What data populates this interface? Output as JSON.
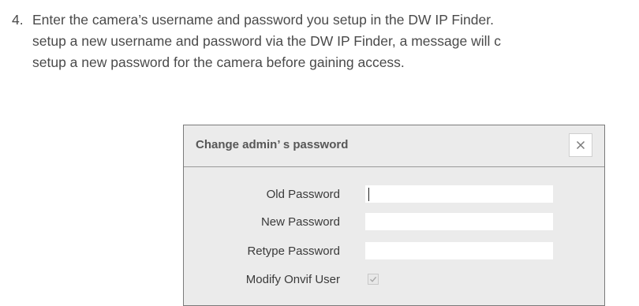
{
  "instruction": {
    "number": "4.",
    "lines": [
      "Enter the camera’s username and password you setup in the DW IP Finder.",
      "setup a new username and password via the DW IP Finder, a message will c",
      "setup a new password for the camera before gaining access."
    ]
  },
  "dialog": {
    "title": "Change admin’ s password",
    "close_icon": "close-icon",
    "fields": [
      {
        "label": "Old Password",
        "value": "",
        "placeholder": ""
      },
      {
        "label": "New Password",
        "value": "",
        "placeholder": ""
      },
      {
        "label": "Retype Password",
        "value": "",
        "placeholder": ""
      }
    ],
    "modify_onvif": {
      "label": "Modify Onvif User",
      "checked": true
    }
  }
}
